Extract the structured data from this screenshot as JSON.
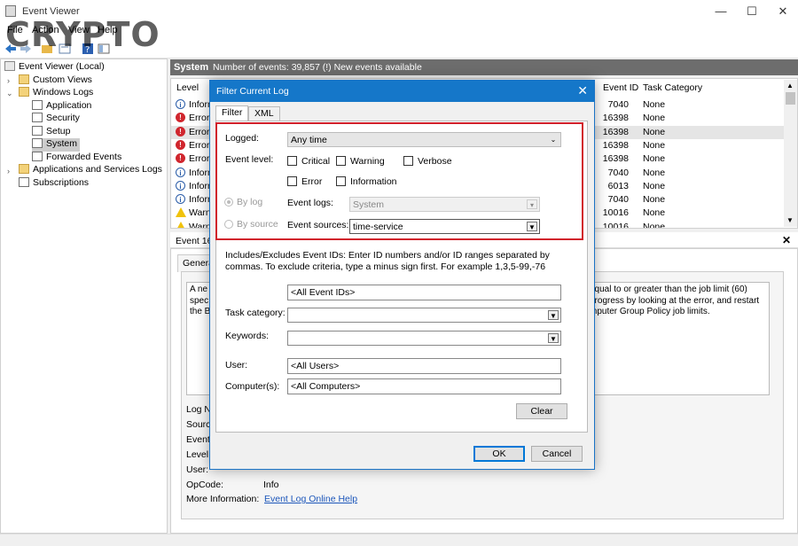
{
  "window": {
    "title": "Event Viewer",
    "controls": {
      "minimize": "—",
      "maximize": "☐",
      "close": "✕"
    }
  },
  "watermark": "CRYPTO",
  "menu": [
    "File",
    "Action",
    "View",
    "Help"
  ],
  "tree": {
    "root": "Event Viewer (Local)",
    "custom_views": "Custom Views",
    "windows_logs": "Windows Logs",
    "windows_log_items": [
      "Application",
      "Security",
      "Setup",
      "System",
      "Forwarded Events"
    ],
    "selected": "System",
    "app_services": "Applications and Services Logs",
    "subscriptions": "Subscriptions"
  },
  "log_header": {
    "name": "System",
    "summary": "Number of events: 39,857 (!) New events available"
  },
  "grid": {
    "columns": {
      "level": "Level",
      "event_id": "Event ID",
      "task_category": "Task Category"
    },
    "rows": [
      {
        "icon": "info-icon",
        "level": "Inform",
        "event_id": "7040",
        "category": "None"
      },
      {
        "icon": "error-icon",
        "level": "Error",
        "event_id": "16398",
        "category": "None"
      },
      {
        "icon": "error-icon",
        "level": "Error",
        "event_id": "16398",
        "category": "None"
      },
      {
        "icon": "error-icon",
        "level": "Error",
        "event_id": "16398",
        "category": "None"
      },
      {
        "icon": "error-icon",
        "level": "Error",
        "event_id": "16398",
        "category": "None"
      },
      {
        "icon": "info-icon",
        "level": "Inform",
        "event_id": "7040",
        "category": "None"
      },
      {
        "icon": "info-icon",
        "level": "Inform",
        "event_id": "6013",
        "category": "None"
      },
      {
        "icon": "info-icon",
        "level": "Inform",
        "event_id": "7040",
        "category": "None"
      },
      {
        "icon": "warning-icon",
        "level": "Warn",
        "event_id": "10016",
        "category": "None"
      },
      {
        "icon": "warning-icon",
        "level": "Warn",
        "event_id": "10016",
        "category": "None"
      }
    ]
  },
  "detail": {
    "header": "Event 16",
    "tab": "Genera",
    "desc_left": [
      "A ne",
      "spec",
      "the B"
    ],
    "desc_right": [
      "equal to or greater than the job limit (60)",
      "progress by looking at the error, and restart",
      "mputer Group Policy job limits."
    ],
    "props": [
      "Log N",
      "Sourc",
      "Event",
      "Level:",
      "User:"
    ],
    "opcode_label": "OpCode:",
    "opcode_value": "Info",
    "moreinfo_label": "More Information:",
    "moreinfo_link": "Event Log Online Help"
  },
  "dialog": {
    "title": "Filter Current Log",
    "tabs": [
      "Filter",
      "XML"
    ],
    "logged_label": "Logged:",
    "logged_value": "Any time",
    "event_level_label": "Event level:",
    "levels": [
      "Critical",
      "Warning",
      "Verbose",
      "Error",
      "Information"
    ],
    "by_log": "By log",
    "by_source": "By source",
    "event_logs_label": "Event logs:",
    "event_logs_value": "System",
    "event_sources_label": "Event sources:",
    "event_sources_value": "time-service",
    "ids_help": "Includes/Excludes Event IDs: Enter ID numbers and/or ID ranges separated by commas. To exclude criteria, type a minus sign first. For example 1,3,5-99,-76",
    "event_ids_value": "<All Event IDs>",
    "task_category_label": "Task category:",
    "keywords_label": "Keywords:",
    "user_label": "User:",
    "user_value": "<All Users>",
    "computers_label": "Computer(s):",
    "computers_value": "<All Computers>",
    "clear": "Clear",
    "ok": "OK",
    "cancel": "Cancel"
  },
  "colors": {
    "dialog_title": "#1577c9",
    "highlight_box": "#d1202b",
    "header_bar": "#6d6d6d"
  }
}
